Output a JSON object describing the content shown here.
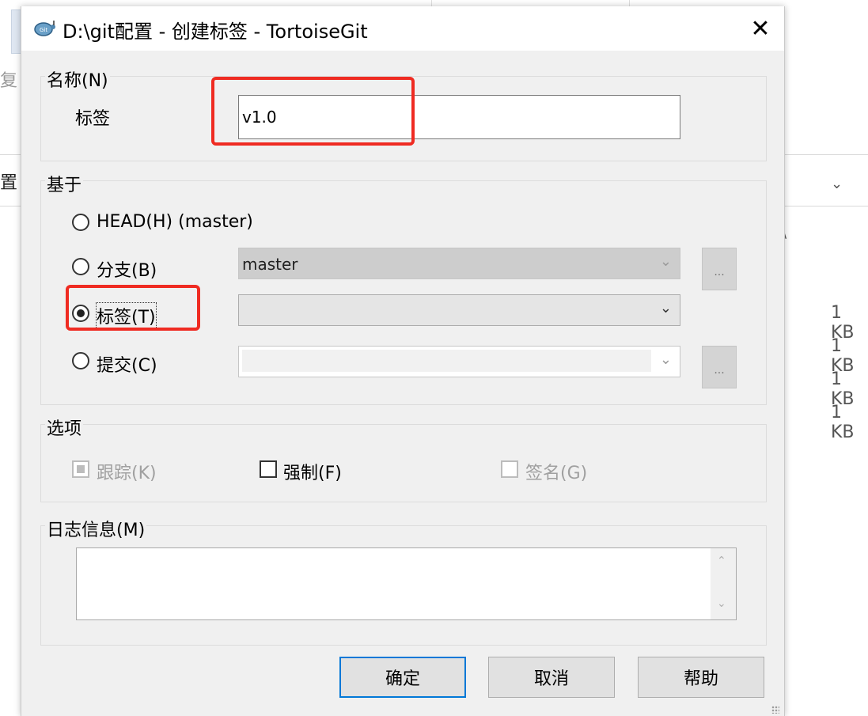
{
  "background": {
    "left_fragment_top": "复",
    "address_fragment": "置",
    "sizes": [
      "1 KB",
      "1 KB",
      "1 KB",
      "1 KB"
    ]
  },
  "dialog": {
    "title": "D:\\git配置 - 创建标签 - TortoiseGit",
    "close_glyph": "✕",
    "name_group": {
      "label": "名称(N)",
      "tag_label": "标签",
      "tag_value": "v1.0"
    },
    "base_group": {
      "label": "基于",
      "options": [
        {
          "label": "HEAD(H) (master)",
          "checked": false
        },
        {
          "label": "分支(B)",
          "checked": false
        },
        {
          "label": "标签(T)",
          "checked": true
        },
        {
          "label": "提交(C)",
          "checked": false
        }
      ],
      "branch_value": "master",
      "tag_value": "",
      "commit_value": "",
      "browse_label": "..."
    },
    "options_group": {
      "label": "选项",
      "track": {
        "label": "跟踪(K)",
        "state": "indeterminate",
        "disabled": true
      },
      "force": {
        "label": "强制(F)",
        "state": "unchecked",
        "disabled": false
      },
      "sign": {
        "label": "签名(G)",
        "state": "unchecked",
        "disabled": true
      }
    },
    "log_group": {
      "label": "日志信息(M)",
      "value": ""
    },
    "buttons": {
      "ok": "确定",
      "cancel": "取消",
      "help": "帮助"
    }
  },
  "colors": {
    "highlight_red": "#ef2b22",
    "default_button_border": "#0078d7",
    "dialog_bg": "#f0f0f0"
  }
}
